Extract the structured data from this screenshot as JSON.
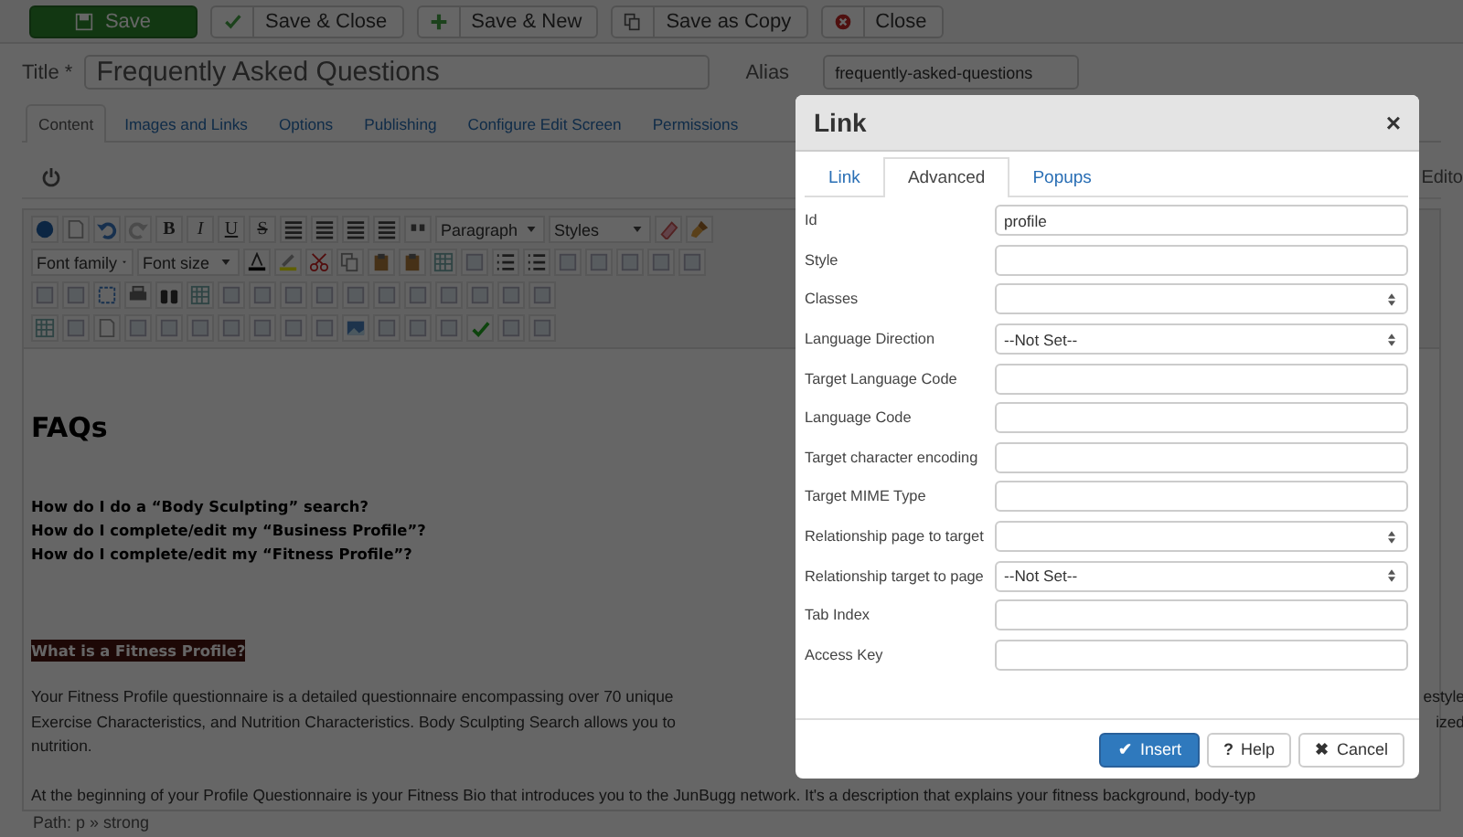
{
  "action_bar": {
    "buttons": [
      {
        "label": "Save",
        "kind": "primary"
      },
      {
        "label": "Save & Close",
        "kind": "default"
      },
      {
        "label": "Save & New",
        "kind": "default"
      },
      {
        "label": "Save as Copy",
        "kind": "default"
      },
      {
        "label": "Close",
        "kind": "default"
      }
    ]
  },
  "article": {
    "title_label": "Title *",
    "title_value": "Frequently Asked Questions",
    "alias_label": "Alias",
    "alias_value": "frequently-asked-questions",
    "tabs": [
      {
        "label": "Content",
        "selected": true
      },
      {
        "label": "Images and Links",
        "selected": false
      },
      {
        "label": "Options",
        "selected": false
      },
      {
        "label": "Publishing",
        "selected": false
      },
      {
        "label": "Configure Edit Screen",
        "selected": false
      },
      {
        "label": "Permissions",
        "selected": false
      }
    ]
  },
  "editor": {
    "toggle_label": "Edito",
    "format_buttons": [
      "B",
      "I",
      "U",
      "S"
    ],
    "block_format": "Paragraph",
    "styles": "Styles",
    "font_family": "Font family",
    "font_size": "Font size",
    "content": {
      "heading": "FAQs",
      "questions": [
        "How do I do a “Body Sculpting” search?",
        "How do I complete/edit my “Business Profile”?",
        "How do I complete/edit my “Fitness Profile”?"
      ],
      "section_heading": "What is a Fitness Profile?",
      "paragraphs": [
        [
          {
            "left": "Your Fitness Profile questionnaire is a detailed questionnaire encompassing over 70 unique",
            "right": "estyle"
          },
          {
            "left": "Exercise Characteristics, and Nutrition Characteristics. Body Sculpting Search allows you to",
            "right": "ized"
          },
          {
            "left": "nutrition."
          }
        ],
        [
          {
            "left": "At the beginning of your Profile Questionnaire is your Fitness Bio that introduces you to the JunBugg network. It's a description that explains your fitness background, body-typ"
          }
        ]
      ]
    },
    "path": "Path: p » strong"
  },
  "dialog": {
    "title": "Link",
    "close": "×",
    "tabs": [
      {
        "label": "Link",
        "selected": false
      },
      {
        "label": "Advanced",
        "selected": true
      },
      {
        "label": "Popups",
        "selected": false
      }
    ],
    "fields": [
      {
        "label": "Id",
        "kind": "text",
        "value": "profile"
      },
      {
        "label": "Style",
        "kind": "text"
      },
      {
        "label": "Classes",
        "kind": "select"
      },
      {
        "label": "Language Direction",
        "kind": "select",
        "value": "--Not Set--"
      },
      {
        "label": "Target Language Code",
        "kind": "text"
      },
      {
        "label": "Language Code",
        "kind": "text"
      },
      {
        "label": "Target character encoding",
        "kind": "text"
      },
      {
        "label": "Target MIME Type",
        "kind": "text"
      },
      {
        "label": "Relationship page to target",
        "kind": "select"
      },
      {
        "label": "Relationship target to page",
        "kind": "select",
        "value": "--Not Set--"
      },
      {
        "label": "Tab Index",
        "kind": "text"
      },
      {
        "label": "Access Key",
        "kind": "text"
      }
    ],
    "buttons": [
      {
        "icon": "✔",
        "label": "Insert",
        "kind": "primary"
      },
      {
        "icon": "?",
        "label": "Help",
        "kind": "default"
      },
      {
        "icon": "✖",
        "label": "Cancel",
        "kind": "default"
      }
    ]
  }
}
